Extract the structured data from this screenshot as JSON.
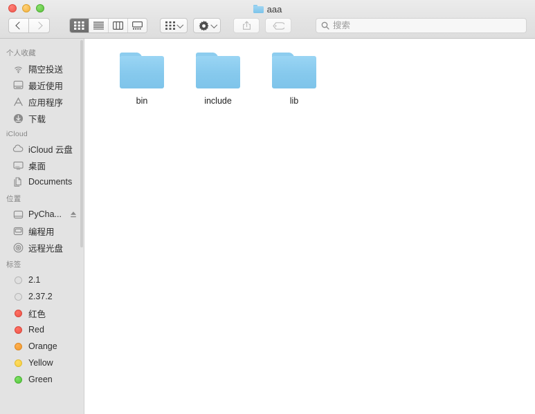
{
  "window": {
    "title": "aaa",
    "title_icon": "folder-icon",
    "traffic_lights": [
      {
        "name": "close-button",
        "color": "#f0554c"
      },
      {
        "name": "minimize-button",
        "color": "#f2b03c"
      },
      {
        "name": "maximize-button",
        "color": "#5cc13d"
      }
    ]
  },
  "toolbar": {
    "back_label": "back-arrow-icon",
    "forward_label": "forward-arrow-icon",
    "view_modes": [
      {
        "name": "icon-view",
        "selected": true
      },
      {
        "name": "list-view",
        "selected": false
      },
      {
        "name": "column-view",
        "selected": false
      },
      {
        "name": "gallery-view",
        "selected": false
      }
    ],
    "arrange_label": "arrange-icon",
    "action_label": "gear-icon",
    "share_label": "share-icon",
    "tag_label": "tag-icon"
  },
  "search": {
    "placeholder": "搜索",
    "value": ""
  },
  "sidebar": {
    "sections": [
      {
        "header": "个人收藏",
        "items": [
          {
            "label": "隔空投送",
            "icon": "airdrop-icon"
          },
          {
            "label": "最近使用",
            "icon": "recents-icon"
          },
          {
            "label": "应用程序",
            "icon": "applications-icon"
          },
          {
            "label": "下载",
            "icon": "downloads-icon"
          }
        ]
      },
      {
        "header": "iCloud",
        "items": [
          {
            "label": "iCloud 云盘",
            "icon": "cloud-icon"
          },
          {
            "label": "桌面",
            "icon": "desktop-icon"
          },
          {
            "label": "Documents",
            "icon": "documents-icon"
          }
        ]
      },
      {
        "header": "位置",
        "items": [
          {
            "label": "PyCha...",
            "icon": "drive-icon",
            "eject": true
          },
          {
            "label": "编程用",
            "icon": "harddisk-icon"
          },
          {
            "label": "远程光盘",
            "icon": "disc-icon"
          }
        ]
      },
      {
        "header": "标签",
        "items": [
          {
            "label": "2.1",
            "icon": "tag-dot",
            "color": "gray"
          },
          {
            "label": "2.37.2",
            "icon": "tag-dot",
            "color": "gray"
          },
          {
            "label": "红色",
            "icon": "tag-dot",
            "color": "red"
          },
          {
            "label": "Red",
            "icon": "tag-dot",
            "color": "red"
          },
          {
            "label": "Orange",
            "icon": "tag-dot",
            "color": "orange"
          },
          {
            "label": "Yellow",
            "icon": "tag-dot",
            "color": "yellow"
          },
          {
            "label": "Green",
            "icon": "tag-dot",
            "color": "green"
          }
        ]
      }
    ]
  },
  "content": {
    "files": [
      {
        "label": "bin",
        "icon": "folder-icon"
      },
      {
        "label": "include",
        "icon": "folder-icon"
      },
      {
        "label": "lib",
        "icon": "folder-icon"
      }
    ]
  }
}
